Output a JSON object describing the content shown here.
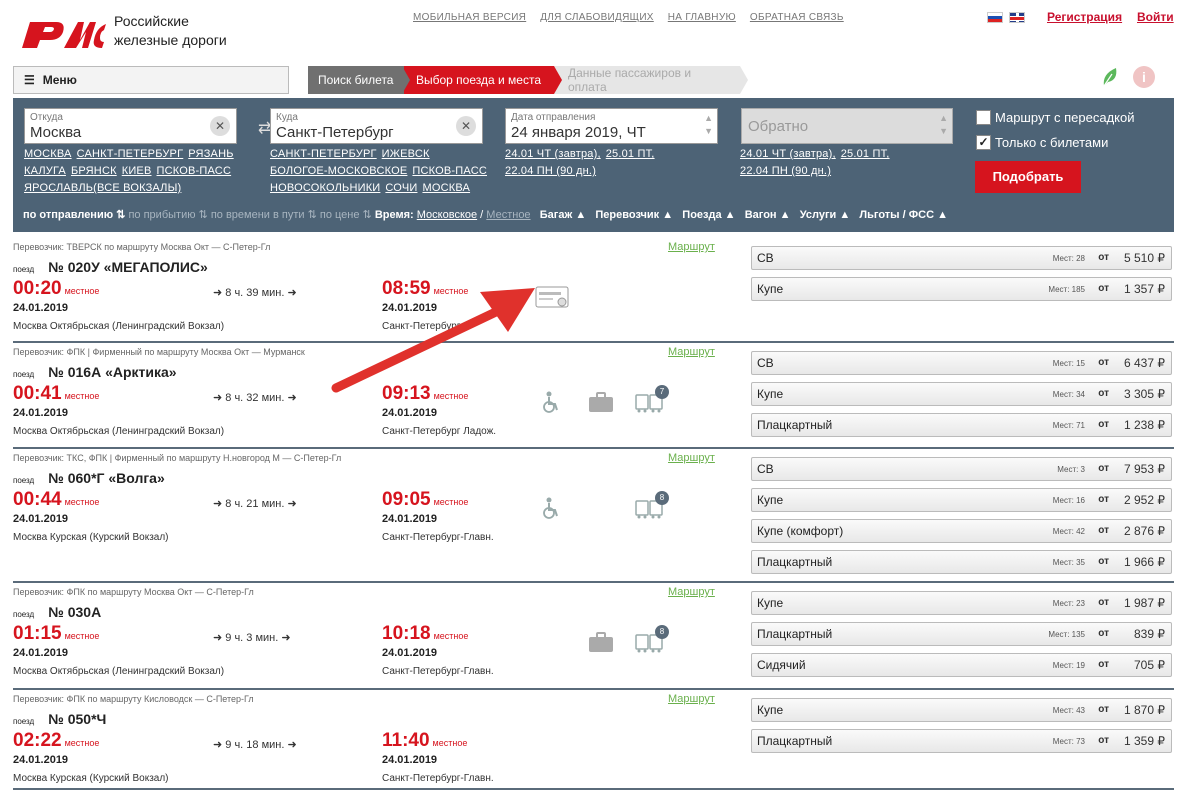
{
  "header": {
    "logo_line1": "Российские",
    "logo_line2": "железные дороги",
    "nav": [
      "МОБИЛЬНАЯ ВЕРСИЯ",
      "ДЛЯ СЛАБОВИДЯЩИХ",
      "НА ГЛАВНУЮ",
      "ОБРАТНАЯ СВЯЗЬ"
    ],
    "register": "Регистрация",
    "login": "Войти"
  },
  "menu_label": "Меню",
  "steps": [
    "Поиск билета",
    "Выбор поезда и места",
    "Данные пассажиров и оплата"
  ],
  "search": {
    "from_label": "Откуда",
    "from_value": "Москва",
    "from_links": [
      "МОСКВА",
      "САНКТ-ПЕТЕРБУРГ",
      "РЯЗАНЬ",
      "КАЛУГА",
      "БРЯНСК",
      "КИЕВ",
      "ПСКОВ-ПАСС",
      "ЯРОСЛАВЛЬ(ВСЕ ВОКЗАЛЫ)"
    ],
    "to_label": "Куда",
    "to_value": "Санкт-Петербург",
    "to_links": [
      "САНКТ-ПЕТЕРБУРГ",
      "ИЖЕВСК",
      "БОЛОГОЕ-МОСКОВСКОЕ",
      "ПСКОВ-ПАСС",
      "НОВОСОКОЛЬНИКИ",
      "СОЧИ",
      "МОСКВА"
    ],
    "date_label": "Дата отправления",
    "date_value": "24 января 2019, ЧТ",
    "date_links": [
      "24.01 ЧТ (завтра),",
      "25.01 ПТ,",
      "22.04 ПН (90 дн.)"
    ],
    "return_placeholder": "Обратно",
    "return_links": [
      "24.01 ЧТ (завтра),",
      "25.01 ПТ,",
      "22.04 ПН (90 дн.)"
    ],
    "transfer_label": "Маршрут с пересадкой",
    "tickets_only_label": "Только с билетами",
    "submit": "Подобрать"
  },
  "sortbar": {
    "by_departure": "по отправлению",
    "by_arrival": "по прибытию",
    "by_duration": "по времени в пути",
    "by_price": "по цене",
    "time_label": "Время:",
    "time_moscow": "Московское",
    "time_local": "Местное",
    "filters": [
      "Багаж",
      "Перевозчик",
      "Поезда",
      "Вагон",
      "Услуги",
      "Льготы / ФСС"
    ]
  },
  "route_link": "Маршрут",
  "train_label": "поезд",
  "local_label": "местное",
  "trains": [
    {
      "carrier": "Перевозчик: ТВЕРСК   по маршруту Москва Окт — С-Петер-Гл",
      "number": "№ 020У «МЕГАПОЛИС»",
      "dep_time": "00:20",
      "dep_date": "24.01.2019",
      "dep_station": "Москва Октябрьская (Ленинградский Вокзал)",
      "duration": "8 ч. 39 мин.",
      "arr_time": "08:59",
      "arr_date": "24.01.2019",
      "arr_station": "Санкт-Петербург",
      "services": [
        "card-icon"
      ],
      "cars": [
        {
          "name": "СВ",
          "seats": "Мест: 28",
          "price": "5 510 ₽"
        },
        {
          "name": "Купе",
          "seats": "Мест: 185",
          "price": "1 357 ₽"
        }
      ]
    },
    {
      "carrier": "Перевозчик: ФПК | Фирменный   по маршруту Москва Окт — Мурманск",
      "number": "№ 016А «Арктика»",
      "dep_time": "00:41",
      "dep_date": "24.01.2019",
      "dep_station": "Москва Октябрьская (Ленинградский Вокзал)",
      "duration": "8 ч. 32 мин.",
      "arr_time": "09:13",
      "arr_date": "24.01.2019",
      "arr_station": "Санкт-Петербург Ладож.",
      "services": [
        "wheelchair-icon",
        "luggage-icon",
        "train-cars-icon"
      ],
      "car_badge": "7",
      "cars": [
        {
          "name": "СВ",
          "seats": "Мест: 15",
          "price": "6 437 ₽"
        },
        {
          "name": "Купе",
          "seats": "Мест: 34",
          "price": "3 305 ₽"
        },
        {
          "name": "Плацкартный",
          "seats": "Мест: 71",
          "price": "1 238 ₽"
        }
      ]
    },
    {
      "carrier": "Перевозчик: ТКС, ФПК | Фирменный   по маршруту Н.новгород М — С-Петер-Гл",
      "number": "№ 060*Г «Волга»",
      "dep_time": "00:44",
      "dep_date": "24.01.2019",
      "dep_station": "Москва Курская (Курский Вокзал)",
      "duration": "8 ч. 21 мин.",
      "arr_time": "09:05",
      "arr_date": "24.01.2019",
      "arr_station": "Санкт-Петербург-Главн.",
      "services": [
        "wheelchair-icon",
        "train-cars-icon"
      ],
      "car_badge": "8",
      "cars": [
        {
          "name": "СВ",
          "seats": "Мест: 3",
          "price": "7 953 ₽"
        },
        {
          "name": "Купе",
          "seats": "Мест: 16",
          "price": "2 952 ₽"
        },
        {
          "name": "Купе    (комфорт)",
          "seats": "Мест: 42",
          "price": "2 876 ₽"
        },
        {
          "name": "Плацкартный",
          "seats": "Мест: 35",
          "price": "1 966 ₽"
        }
      ]
    },
    {
      "carrier": "Перевозчик: ФПК   по маршруту Москва Окт — С-Петер-Гл",
      "number": "№ 030А",
      "dep_time": "01:15",
      "dep_date": "24.01.2019",
      "dep_station": "Москва Октябрьская (Ленинградский Вокзал)",
      "duration": "9 ч. 3 мин.",
      "arr_time": "10:18",
      "arr_date": "24.01.2019",
      "arr_station": "Санкт-Петербург-Главн.",
      "services": [
        "luggage-icon",
        "train-cars-icon"
      ],
      "car_badge": "8",
      "cars": [
        {
          "name": "Купе",
          "seats": "Мест: 23",
          "price": "1 987 ₽"
        },
        {
          "name": "Плацкартный",
          "seats": "Мест: 135",
          "price": "839 ₽"
        },
        {
          "name": "Сидячий",
          "seats": "Мест: 19",
          "price": "705 ₽"
        }
      ]
    },
    {
      "carrier": "Перевозчик: ФПК   по маршруту Кисловодск — С-Петер-Гл",
      "number": "№ 050*Ч",
      "dep_time": "02:22",
      "dep_date": "24.01.2019",
      "dep_station": "Москва Курская (Курский Вокзал)",
      "duration": "9 ч. 18 мин.",
      "arr_time": "11:40",
      "arr_date": "24.01.2019",
      "arr_station": "Санкт-Петербург-Главн.",
      "services": [],
      "cars": [
        {
          "name": "Купе",
          "seats": "Мест: 43",
          "price": "1 870 ₽"
        },
        {
          "name": "Плацкартный",
          "seats": "Мест: 73",
          "price": "1 359 ₽"
        }
      ]
    }
  ],
  "price_prefix": "от",
  "colors": {
    "brand_red": "#d6141e",
    "panel": "#4d6376",
    "route_green": "#6ab04c"
  }
}
